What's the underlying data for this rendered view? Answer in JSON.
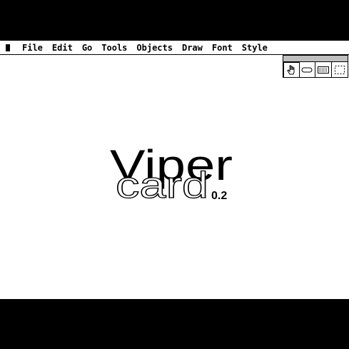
{
  "menubar": {
    "items": [
      "File",
      "Edit",
      "Go",
      "Tools",
      "Objects",
      "Draw",
      "Font",
      "Style"
    ]
  },
  "tool_palette": {
    "tools": [
      "browse-hand",
      "button",
      "field",
      "select"
    ],
    "selected": "browse-hand"
  },
  "logo": {
    "word1": "Viper",
    "word2": "card",
    "version": "0.2"
  },
  "colors": {
    "foreground": "#000000",
    "background": "#ffffff"
  }
}
